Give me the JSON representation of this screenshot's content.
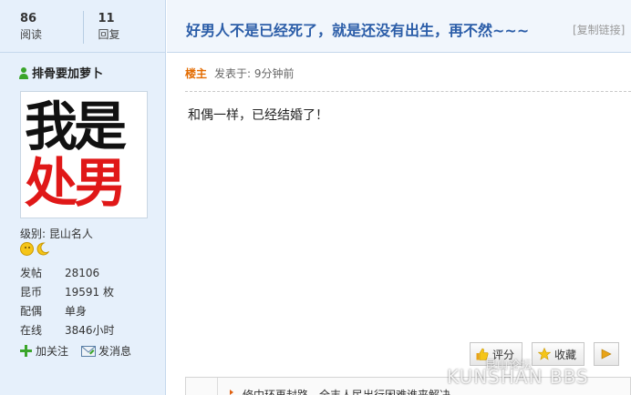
{
  "stats": {
    "views_count": "86",
    "views_label": "阅读",
    "replies_count": "11",
    "replies_label": "回复"
  },
  "user": {
    "name": "排骨要加萝卜",
    "avatar_text_line1": "我是",
    "avatar_text_line2": "处男",
    "level_label": "级别:",
    "level_value": "昆山名人",
    "info": [
      {
        "key": "发帖",
        "value": "28106"
      },
      {
        "key": "昆币",
        "value": "19591 枚"
      },
      {
        "key": "配偶",
        "value": "单身"
      },
      {
        "key": "在线",
        "value": "3846小时"
      }
    ],
    "follow_label": "加关注",
    "message_label": "发消息"
  },
  "thread": {
    "title": "好男人不是已经死了，就是还没有出生，再不然~~~",
    "copy_link": "[复制链接]"
  },
  "post": {
    "floor_label": "楼主",
    "posted_time": "发表于: 9分钟前",
    "body": "和偶一样，已经结婚了！"
  },
  "buttons": {
    "rate": "评分",
    "favorite": "收藏"
  },
  "signature": {
    "text": "修中环再封路，全丰人民出行困难谁来解决",
    "text2": "昆山"
  },
  "watermark": {
    "cn": "昆山论坛",
    "en": "KUNSHAN BBS"
  },
  "colors": {
    "link_blue": "#2b5da8",
    "floor_orange": "#e36b00",
    "sidebar_bg": "#e6f0fb"
  }
}
